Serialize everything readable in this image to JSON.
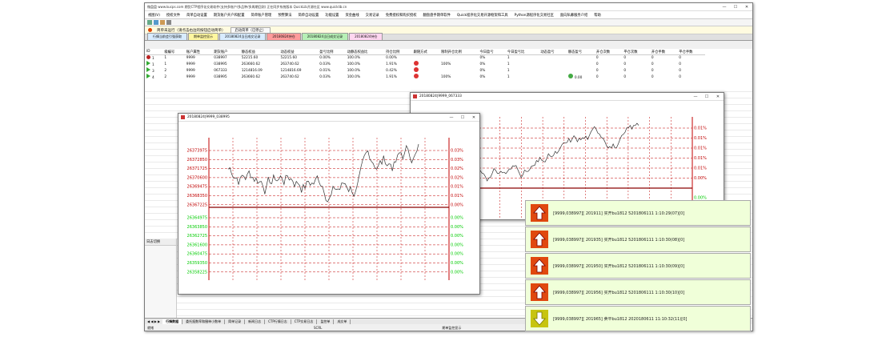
{
  "app": {
    "title": "微盘盘 www.kucps.com 期货CTP程序化交易软件(支持多账户/多品种/多周期回测) 正在同步系统版本 QuickLib开源社区 www.quicklib.cn",
    "menu": [
      "视图(V)",
      "授权文件",
      "简单自动设置",
      "期货账户开户和配置",
      "简单账户管理",
      "预警算法",
      "简单自动设置",
      "功能设置",
      "资金曲线",
      "交易记录",
      "免费授权和购买授权",
      "翻盘盘手期单软件",
      "Quick程序化交易开源框架和工具",
      "Python源程序化交易社区",
      "面向私募服务介绍",
      "帮助"
    ],
    "status_label": "简单未运行（请点击右边的按钮启动简单）",
    "start_button": "启动简单（已停止）",
    "tabs": [
      "行情当前会引强获取",
      "期单监控显示",
      "20180824当日成交记录",
      "20180824持仓",
      "20180824当日成交记录",
      "20180824持仓"
    ],
    "bottom_tabs": [
      "行情数据",
      "委托报数率和撤单小数单",
      "简单记录",
      "新闻日志",
      "CTP行情日志",
      "CTP交易日志",
      "监控单",
      "成交单"
    ],
    "left_panel_label": "日志切换",
    "status_left": "就绪",
    "status_mid": "SCRL",
    "status_right": "期单监控显示"
  },
  "table": {
    "headers": [
      "ID",
      "级编号",
      "账户属性",
      "期货账户",
      "静态权益",
      "动态权益",
      "盈亏比例",
      "动静态权益比",
      "持仓比例",
      "跟随方式",
      "限制开仓比例",
      "今日盈亏",
      "今日盈亏比",
      "动态盈亏",
      "静态盈亏",
      "开仓次数",
      "平仓次数",
      "开仓手数",
      "平仓手数"
    ],
    "rows": [
      [
        "1",
        "1",
        "9999",
        "038997",
        "52215.60",
        "52215.60",
        "0.00%",
        "100.0%",
        "0.00%",
        "",
        "",
        "0%",
        "1",
        "",
        "",
        "0",
        "0",
        "0",
        "0"
      ],
      [
        "1",
        "1",
        "9999",
        "038995",
        "263660.62",
        "263740.62",
        "0.03%",
        "100.0%",
        "1.91%",
        "",
        "100%",
        "0%",
        "1",
        "",
        "",
        "0",
        "0",
        "0",
        "0"
      ],
      [
        "3",
        "2",
        "9999",
        "067333",
        "1214816.09",
        "1214816.69",
        "0.01%",
        "100.0%",
        "0.42%",
        "",
        "",
        "0%",
        "1",
        "",
        "",
        "0",
        "0",
        "0",
        "0"
      ],
      [
        "4",
        "2",
        "9999",
        "038995",
        "263660.62",
        "263740.62",
        "0.03%",
        "100.0%",
        "1.91%",
        "",
        "100%",
        "0%",
        "1",
        "",
        "0.00",
        "0",
        "0",
        "0",
        "0"
      ]
    ]
  },
  "chart1": {
    "title": "20180824|9999_038995",
    "left_ticks_red": [
      "26373975",
      "26372850",
      "26371725",
      "26370600",
      "26369475",
      "26368350",
      "26367225"
    ],
    "left_ticks_green": [
      "26364975",
      "26363850",
      "26362725",
      "26361600",
      "26360475",
      "26359350",
      "26358225"
    ],
    "right_ticks_red": [
      "0.03%",
      "0.03%",
      "0.02%",
      "0.02%",
      "0.01%",
      "0.01%",
      "0.00%"
    ],
    "right_ticks_green": [
      "0.00%",
      "0.00%",
      "0.00%",
      "0.00%",
      "0.00%",
      "0.00%",
      "0.00%"
    ]
  },
  "chart2": {
    "title": "20180824|9999_067333",
    "right_ticks_red": [
      "0.01%",
      "0.01%",
      "0.01%",
      "0.01%",
      "0.01%",
      "0.00%"
    ],
    "right_ticks_green": [
      "0.00%"
    ]
  },
  "notifications": [
    {
      "dir": "up",
      "text": "[9999,038997][ 201911] 买开bu1812 5201806111 1:10:29(07)[0]"
    },
    {
      "dir": "up",
      "text": "[9999,038997][ 201935] 买开bu1812 5201806111 1:10:30(08)[0]"
    },
    {
      "dir": "up",
      "text": "[9999,038997][ 201950] 买开bu1812 5201806111 1:10:30(09)[0]"
    },
    {
      "dir": "up",
      "text": "[9999,038997][ 201956] 买开bu1812 5201806111 1:10:30(10)[0]"
    },
    {
      "dir": "down",
      "text": "[9999,038997][ 201965] 卖平bu1812 2020180611 11:10:32(11)[0]"
    }
  ],
  "colors": {
    "up": "#e0480f",
    "down": "#c7c40f",
    "red_line": "#c00000",
    "green_text": "#00cc00"
  }
}
